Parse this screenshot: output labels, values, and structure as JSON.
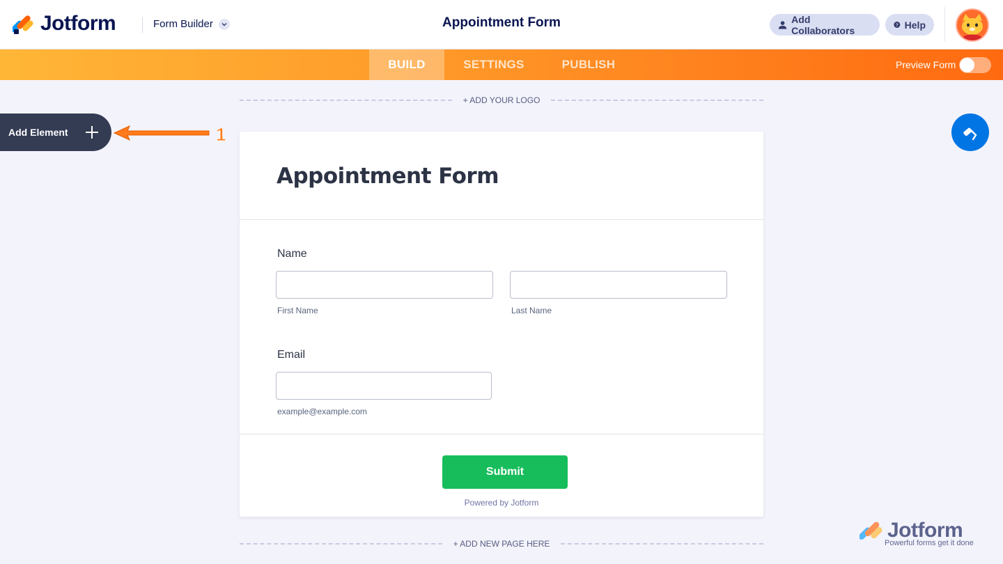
{
  "header": {
    "logo_text": "Jotform",
    "form_builder_label": "Form Builder",
    "title": "Appointment Form",
    "collaborators_label": "Add Collaborators",
    "help_label": "Help"
  },
  "nav": {
    "tabs": [
      "BUILD",
      "SETTINGS",
      "PUBLISH"
    ],
    "active_tab": "BUILD",
    "preview_label": "Preview Form",
    "preview_on": false
  },
  "canvas": {
    "add_logo": "+ ADD YOUR LOGO",
    "add_page": "+ ADD NEW PAGE HERE",
    "add_element_label": "Add Element",
    "annotation_number": "1"
  },
  "form": {
    "title": "Appointment Form",
    "name_label": "Name",
    "first_name_sublabel": "First Name",
    "last_name_sublabel": "Last Name",
    "email_label": "Email",
    "email_sublabel": "example@example.com",
    "submit_label": "Submit",
    "powered_by": "Powered by Jotform"
  },
  "watermark": {
    "brand": "Jotform",
    "tagline": "Powerful forms get it done"
  },
  "colors": {
    "navy": "#0a1551",
    "orange_start": "#ffb637",
    "orange_end": "#ff6a10",
    "submit_green": "#18bd5b",
    "paint_blue": "#0075e3",
    "add_element_bg": "#343c54"
  }
}
